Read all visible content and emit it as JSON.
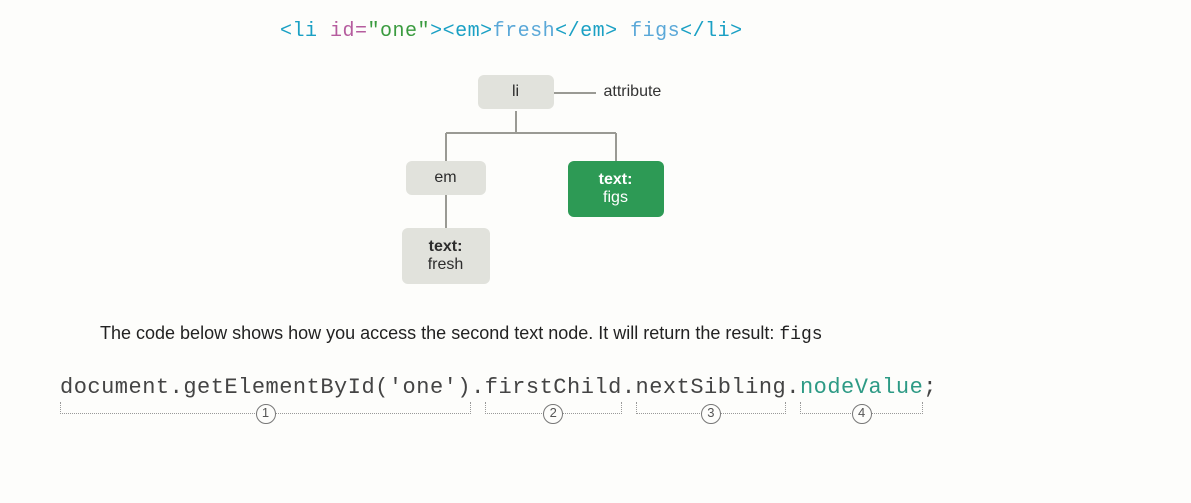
{
  "code": {
    "open_tag": "<li",
    "space": "  ",
    "attr_name": "id=",
    "attr_val": "\"one\"",
    "close_open": "><em>",
    "text1": "fresh",
    "mid": "</em>",
    "space2": " ",
    "text2": "figs",
    "close": "</li>"
  },
  "nodes": {
    "li": "li",
    "attribute": "attribute",
    "em": "em",
    "text_figs_1": "text:",
    "text_figs_2": "figs",
    "text_fresh_1": "text:",
    "text_fresh_2": "fresh"
  },
  "explain": {
    "prefix": "The code below shows how you access the second text node. It will return the result: ",
    "result": "figs"
  },
  "js": {
    "seg1": "document.getElementById('one')",
    "dot1": ".",
    "seg2": "firstChild",
    "dot2": ".",
    "seg3": "nextSibling",
    "dot3": ".",
    "seg4": "nodeValue",
    "semi": ";"
  },
  "brackets": {
    "b1": "1",
    "b2": "2",
    "b3": "3",
    "b4": "4"
  }
}
